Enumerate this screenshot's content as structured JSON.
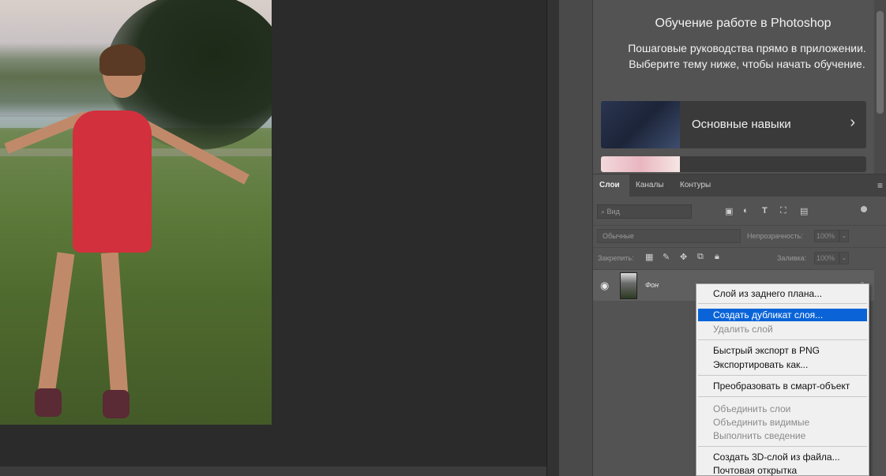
{
  "learn": {
    "title": "Обучение работе в Photoshop",
    "description": "Пошаговые руководства прямо в приложении. Выберите тему ниже, чтобы начать обучение.",
    "cards": [
      {
        "label": "Основные навыки"
      }
    ]
  },
  "layers_panel": {
    "tabs": [
      "Слои",
      "Каналы",
      "Контуры"
    ],
    "filter_placeholder": "Вид",
    "blend_mode": "Обычные",
    "opacity_label": "Непрозрачность:",
    "opacity_value": "100%",
    "lock_label": "Закрепить:",
    "fill_label": "Заливка:",
    "fill_value": "100%",
    "layer_name": "Фон"
  },
  "context_menu": {
    "items": [
      {
        "label": "Слой из заднего плана...",
        "enabled": true
      },
      {
        "label": "Создать дубликат слоя...",
        "enabled": true,
        "highlighted": true
      },
      {
        "label": "Удалить слой",
        "enabled": false
      },
      {
        "label": "Быстрый экспорт в PNG",
        "enabled": true
      },
      {
        "label": "Экспортировать как...",
        "enabled": true
      },
      {
        "label": "Преобразовать в смарт-объект",
        "enabled": true
      },
      {
        "label": "Объединить слои",
        "enabled": false
      },
      {
        "label": "Объединить видимые",
        "enabled": false
      },
      {
        "label": "Выполнить сведение",
        "enabled": false
      },
      {
        "label": "Создать 3D-слой из файла...",
        "enabled": true
      },
      {
        "label": "Почтовая открытка",
        "enabled": true
      }
    ]
  },
  "colors": {
    "menu_highlight": "#0a64d8",
    "panel_bg": "#535353",
    "canvas_bg": "#2b2b2b"
  }
}
